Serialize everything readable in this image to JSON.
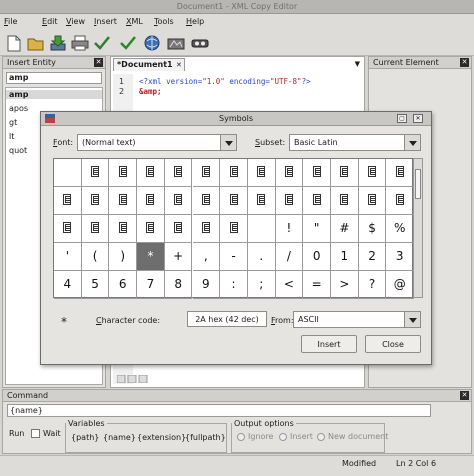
{
  "window": {
    "title": "Document1 - XML Copy Editor"
  },
  "menu": [
    "File",
    "Edit",
    "View",
    "Insert",
    "XML",
    "Tools",
    "Help"
  ],
  "toolbar_icons": [
    "new-file-icon",
    "open-file-icon",
    "save-icon",
    "print-icon",
    "check-wellformed-icon",
    "validate-icon",
    "browser-icon",
    "xslt-icon",
    "xpath-icon"
  ],
  "insert_entity": {
    "title": "Insert Entity",
    "filter_value": "amp",
    "items": [
      "amp",
      "apos",
      "gt",
      "lt",
      "quot"
    ],
    "selected": "amp"
  },
  "document": {
    "tab_label": "*Document1",
    "lines": [
      {
        "no": "1",
        "open": "<?xml",
        "attr1": "version=",
        "val1": "\"1.0\"",
        "attr2": "encoding=",
        "val2": "\"UTF-8\"",
        "close": "?>"
      },
      {
        "no": "2",
        "text": "&amp;"
      }
    ]
  },
  "current_element": {
    "title": "Current Element"
  },
  "symbols_dialog": {
    "title": "Symbols",
    "font_label": "Font:",
    "font_value": "(Normal text)",
    "subset_label": "Subset:",
    "subset_value": "Basic Latin",
    "grid_rows": [
      [
        "",
        "□",
        "□",
        "□",
        "□",
        "□",
        "□",
        "□",
        "□",
        "□",
        "□",
        "□",
        "□"
      ],
      [
        "□",
        "□",
        "□",
        "□",
        "□",
        "□",
        "□",
        "□",
        "□",
        "□",
        "□",
        "□",
        "□"
      ],
      [
        "□",
        "□",
        "□",
        "□",
        "□",
        "□",
        "□",
        "",
        "!",
        "\"",
        "#",
        "$",
        "%",
        "&"
      ],
      [
        "'",
        "(",
        ")",
        "*",
        "+",
        ",",
        "-",
        ".",
        "/",
        "0",
        "1",
        "2",
        "3"
      ],
      [
        "4",
        "5",
        "6",
        "7",
        "8",
        "9",
        ":",
        ";",
        "<",
        "=",
        ">",
        "?",
        "@"
      ]
    ],
    "selected_char": "*",
    "character_code_label": "Character code:",
    "character_code_value": "2A hex (42 dec)",
    "from_label": "From:",
    "from_value": "ASCII",
    "insert_label": "Insert",
    "close_label": "Close"
  },
  "command": {
    "title": "Command",
    "input_value": "{name}",
    "run_label": "Run",
    "wait_label": "Wait",
    "variables_label": "Variables",
    "variables": [
      "{path}",
      "{name}",
      "{extension}",
      "{fullpath}"
    ],
    "output_label": "Output options",
    "output_options": [
      "Ignore",
      "Insert",
      "New document"
    ]
  },
  "status": {
    "modified": "Modified",
    "position": "Ln 2 Col 6"
  }
}
